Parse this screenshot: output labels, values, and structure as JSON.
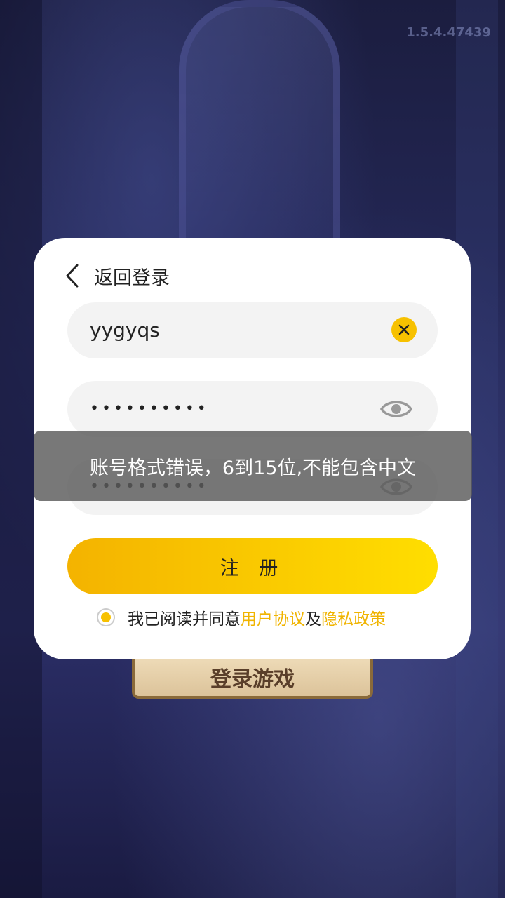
{
  "version": "1.5.4.47439",
  "background": {
    "game_login_label": "登录游戏"
  },
  "dialog": {
    "back_label": "返回登录",
    "username_value": "yygyqs",
    "password_masked": "••••••••••",
    "confirm_password_masked": "••••••••••",
    "register_label": "注 册",
    "agree_text": "我已阅读并同意",
    "user_agreement_link": "用户协议",
    "and_text": "及",
    "privacy_policy_link": "隐私政策",
    "agree_checked": true
  },
  "toast": {
    "message": "账号格式错误，6到15位,不能包含中文"
  },
  "colors": {
    "accent": "#f7c100",
    "link": "#f0b400",
    "button_gradient_start": "#f4b300",
    "button_gradient_end": "#ffde00"
  },
  "icons": {
    "back": "chevron-left-icon",
    "clear": "close-icon",
    "password_toggle": "eye-icon"
  }
}
